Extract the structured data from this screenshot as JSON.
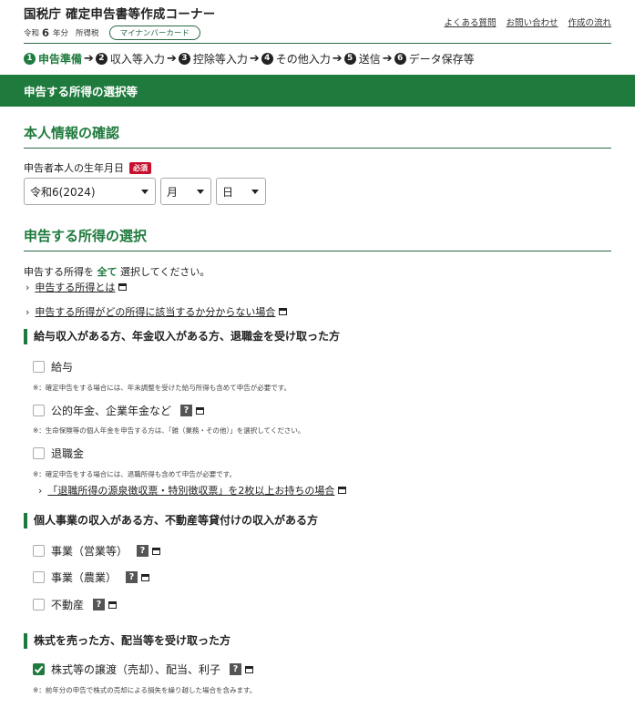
{
  "header": {
    "site_title": "国税庁 確定申告書等作成コーナー",
    "era_prefix": "令和",
    "era_year": "6",
    "era_suffix": "年分",
    "tax_type": "所得税",
    "mynumber_pill": "マイナンバーカード",
    "links": [
      "よくある質問",
      "お問い合わせ",
      "作成の流れ"
    ]
  },
  "steps": [
    {
      "num": "1",
      "label": "申告準備",
      "active": true
    },
    {
      "num": "2",
      "label": "収入等入力"
    },
    {
      "num": "3",
      "label": "控除等入力"
    },
    {
      "num": "4",
      "label": "その他入力"
    },
    {
      "num": "5",
      "label": "送信"
    },
    {
      "num": "6",
      "label": "データ保存等"
    }
  ],
  "banner_title": "申告する所得の選択等",
  "personal": {
    "heading": "本人情報の確認",
    "birth_label": "申告者本人の生年月日",
    "required_badge": "必須",
    "era_select": "令和6(2024)",
    "month_select": "月",
    "day_select": "日"
  },
  "income": {
    "heading": "申告する所得の選択",
    "instruction_pre": "申告する所得を",
    "instruction_emph": "全て",
    "instruction_post": "選択してください。",
    "link1": "申告する所得とは",
    "link2": "申告する所得がどの所得に該当するか分からない場合"
  },
  "group1": {
    "title": "給与収入がある方、年金収入がある方、退職金を受け取った方",
    "item_salary": "給与",
    "note_salary": "※：確定申告をする場合には、年末調整を受けた給与所得も含めて申告が必要です。",
    "item_pension": "公的年金、企業年金など",
    "note_pension": "※：生命保険等の個人年金を申告する方は、「雑（業務・その他）」を選択してください。",
    "item_retire": "退職金",
    "note_retire": "※：確定申告をする場合には、退職所得も含めて申告が必要です。",
    "link_retire": "「退職所得の源泉徴収票・特別徴収票」を2枚以上お持ちの場合"
  },
  "group2": {
    "title": "個人事業の収入がある方、不動産等貸付けの収入がある方",
    "item_business": "事業（営業等）",
    "item_farm": "事業（農業）",
    "item_realestate": "不動産"
  },
  "group3": {
    "title": "株式を売った方、配当等を受け取った方",
    "item_stock": "株式等の譲渡（売却）、配当、利子",
    "stock_checked": true,
    "note_stock": "※：前年分の申告で株式の売却による損失を繰り越した場合を含みます。"
  },
  "help_glyph": "?",
  "colors": {
    "accent": "#1f7a3d",
    "required": "#c8102e"
  }
}
